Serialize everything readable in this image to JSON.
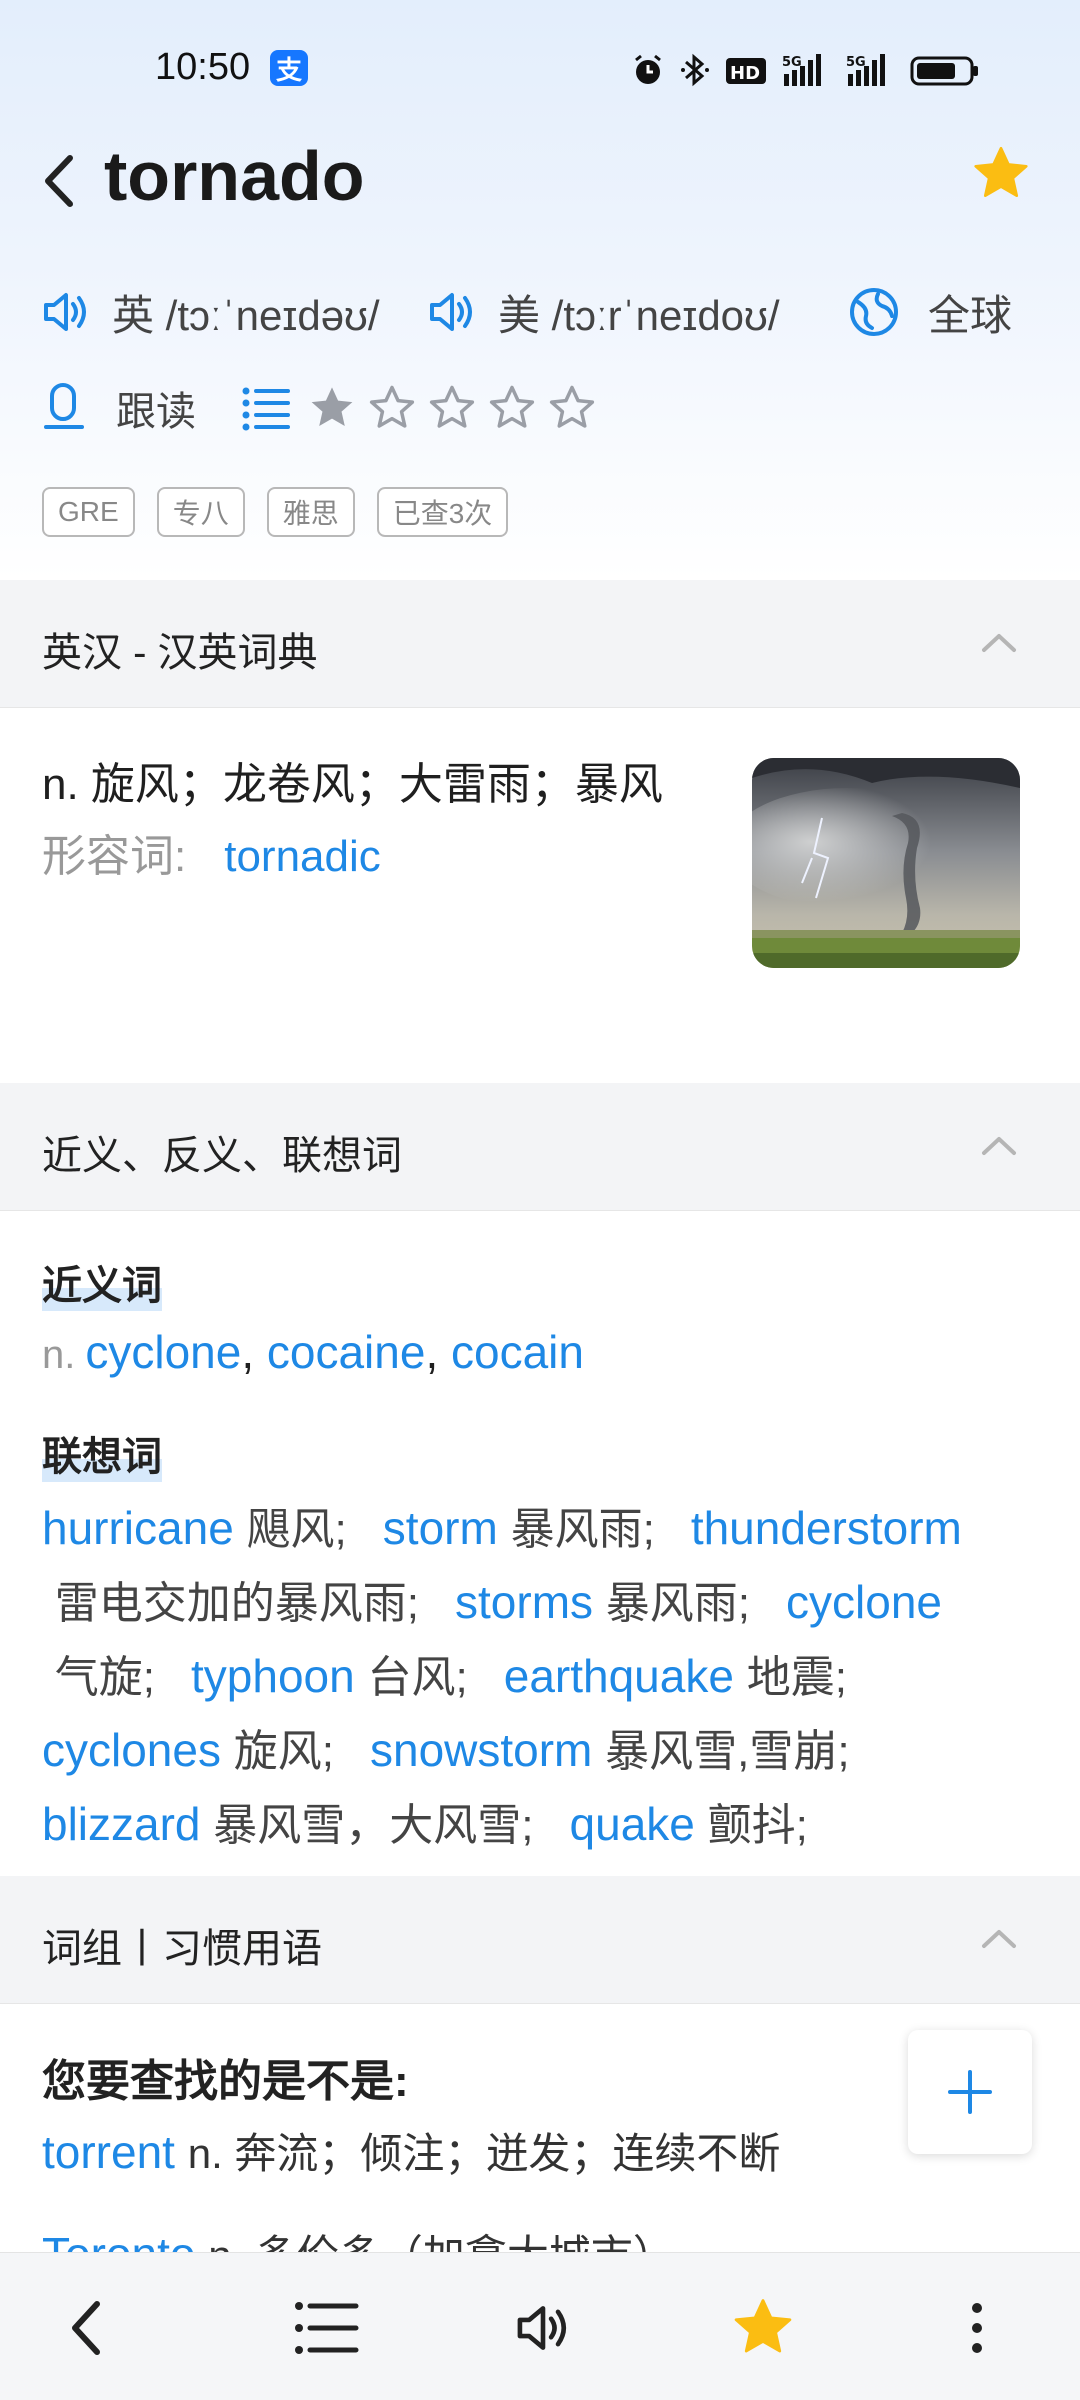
{
  "status_bar": {
    "time": "10:50",
    "alipay_glyph": "支",
    "icons": [
      "alarm-icon",
      "bluetooth-icon",
      "hd-icon",
      "5g-signal-icon",
      "5g-signal-icon",
      "battery-icon"
    ]
  },
  "header": {
    "word": "tornado",
    "favorited": true
  },
  "pronunciation": {
    "uk_label": "英 /tɔːˈneɪdəʊ/",
    "us_label": "美 /tɔːrˈneɪdoʊ/",
    "global_label": "全球"
  },
  "practice": {
    "read_label": "跟读",
    "star_rating": 1,
    "star_max": 5
  },
  "tags": [
    "GRE",
    "专八",
    "雅思",
    "已查3次"
  ],
  "dictionary": {
    "title": "英汉 - 汉英词典",
    "definition": "n. 旋风；龙卷风；大雷雨；暴风",
    "adj_label": "形容词:",
    "adj_word": "tornadic"
  },
  "related": {
    "title": "近义、反义、联想词",
    "synonyms_title": "近义词",
    "synonyms_pos": "n.",
    "synonyms": [
      "cyclone",
      "cocaine",
      "cocain"
    ],
    "assoc_title": "联想词",
    "assoc": [
      {
        "en": "hurricane",
        "cn": "飓风;"
      },
      {
        "en": "storm",
        "cn": "暴风雨;"
      },
      {
        "en": "thunderstorm",
        "cn": "雷电交加的暴风雨;"
      },
      {
        "en": "storms",
        "cn": "暴风雨;"
      },
      {
        "en": "cyclone",
        "cn": "气旋;"
      },
      {
        "en": "typhoon",
        "cn": "台风;"
      },
      {
        "en": "earthquake",
        "cn": "地震;"
      },
      {
        "en": "cyclones",
        "cn": "旋风;"
      },
      {
        "en": "snowstorm",
        "cn": "暴风雪,雪崩;"
      },
      {
        "en": "blizzard",
        "cn": "暴风雪，大风雪;"
      },
      {
        "en": "quake",
        "cn": "颤抖;"
      }
    ]
  },
  "phrases": {
    "title": "词组丨习惯用语",
    "question": "您要查找的是不是:",
    "suggestions": [
      {
        "en": "torrent",
        "cn": "n. 奔流；倾注；迸发；连续不断"
      },
      {
        "en": "Toronto",
        "cn": "n. 多伦多（加拿大城市）"
      }
    ]
  },
  "colors": {
    "accent": "#1e88e5",
    "star": "#fbbd12"
  }
}
